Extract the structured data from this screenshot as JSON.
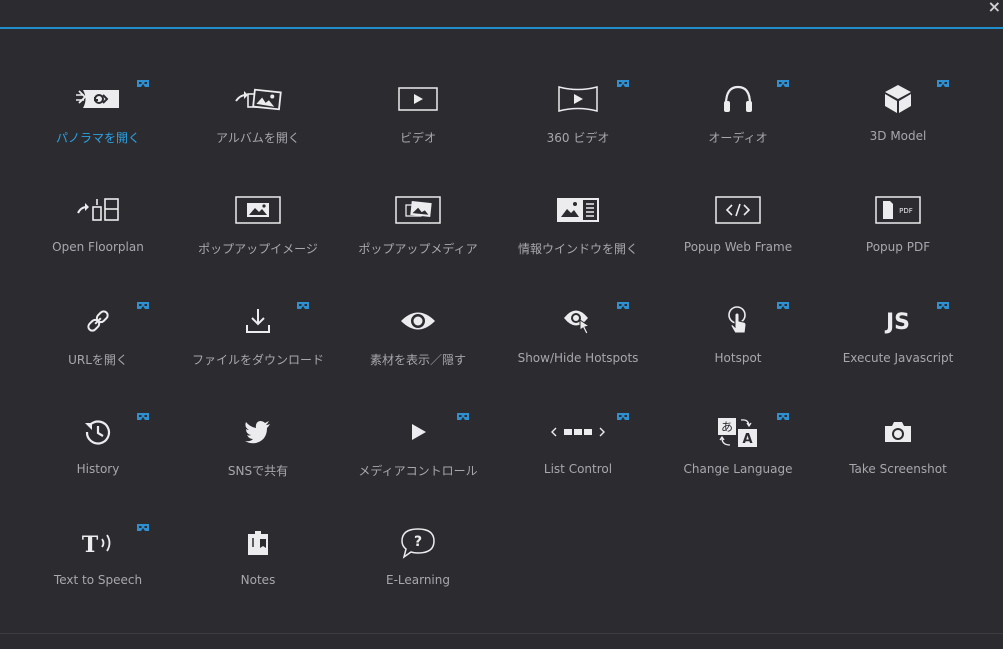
{
  "window": {
    "close_glyph": "×"
  },
  "colors": {
    "accent": "#1f8ecb",
    "label": "#a8a7ad",
    "active_label": "#29a3e6",
    "icon": "#ececee",
    "vr_badge": "#2e8fd1"
  },
  "items": [
    {
      "label": "パノラマを開く",
      "icon": "open-panorama-icon",
      "vr": true,
      "active": true
    },
    {
      "label": "アルバムを開く",
      "icon": "open-album-icon",
      "vr": false
    },
    {
      "label": "ビデオ",
      "icon": "video-icon",
      "vr": false
    },
    {
      "label": "360 ビデオ",
      "icon": "video-360-icon",
      "vr": true
    },
    {
      "label": "オーディオ",
      "icon": "headphones-icon",
      "vr": true
    },
    {
      "label": "3D Model",
      "icon": "cube-icon",
      "vr": true
    },
    {
      "label": "Open Floorplan",
      "icon": "floorplan-icon",
      "vr": false
    },
    {
      "label": "ポップアップイメージ",
      "icon": "popup-image-icon",
      "vr": false
    },
    {
      "label": "ポップアップメディア",
      "icon": "popup-media-icon",
      "vr": false
    },
    {
      "label": "情報ウインドウを開く",
      "icon": "info-window-icon",
      "vr": false
    },
    {
      "label": "Popup Web Frame",
      "icon": "code-frame-icon",
      "vr": false
    },
    {
      "label": "Popup PDF",
      "icon": "pdf-icon",
      "vr": false,
      "icon_text": "PDF"
    },
    {
      "label": "URLを開く",
      "icon": "link-icon",
      "vr": true
    },
    {
      "label": "ファイルをダウンロード",
      "icon": "download-icon",
      "vr": true
    },
    {
      "label": "素材を表示／隠す",
      "icon": "eye-icon",
      "vr": false
    },
    {
      "label": "Show/Hide Hotspots",
      "icon": "hotspot-eye-icon",
      "vr": true
    },
    {
      "label": "Hotspot",
      "icon": "hand-pointer-icon",
      "vr": true
    },
    {
      "label": "Execute Javascript",
      "icon": "js-icon",
      "vr": true,
      "icon_text": "JS"
    },
    {
      "label": "History",
      "icon": "history-icon",
      "vr": true
    },
    {
      "label": "SNSで共有",
      "icon": "twitter-icon",
      "vr": false
    },
    {
      "label": "メディアコントロール",
      "icon": "play-icon",
      "vr": true
    },
    {
      "label": "List Control",
      "icon": "list-control-icon",
      "vr": true
    },
    {
      "label": "Change Language",
      "icon": "translate-icon",
      "vr": true,
      "icon_text_a": "あ",
      "icon_text_b": "A"
    },
    {
      "label": "Take Screenshot",
      "icon": "camera-icon",
      "vr": false
    },
    {
      "label": "Text to Speech",
      "icon": "text-to-speech-icon",
      "vr": true,
      "icon_text": "T"
    },
    {
      "label": "Notes",
      "icon": "notes-icon",
      "vr": false
    },
    {
      "label": "E-Learning",
      "icon": "elearning-icon",
      "vr": false,
      "icon_text": "?"
    }
  ]
}
